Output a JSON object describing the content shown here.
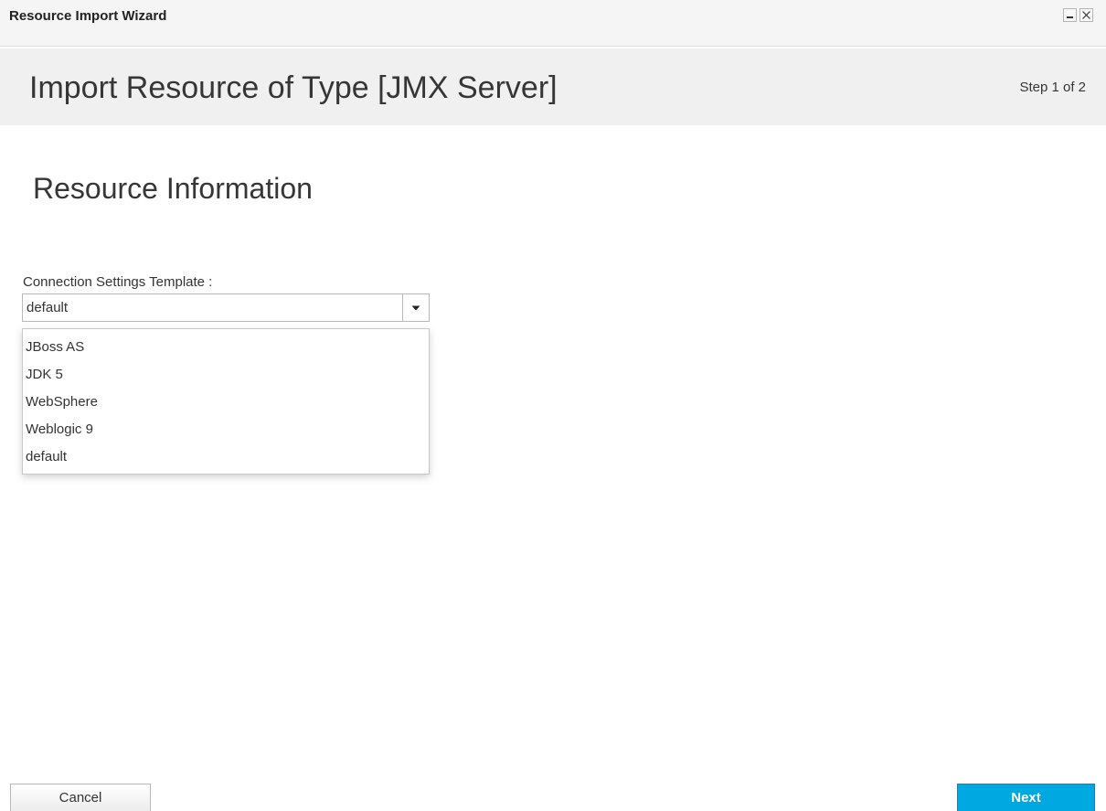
{
  "window": {
    "title": "Resource Import Wizard",
    "minimize_icon": "minimize-icon",
    "close_icon": "close-icon"
  },
  "header": {
    "title": "Import Resource of Type [JMX Server]",
    "step": "Step 1 of 2"
  },
  "section": {
    "title": "Resource Information"
  },
  "form": {
    "connection_template": {
      "label": "Connection Settings Template :",
      "selected": "default",
      "arrow_icon": "caret-down-icon",
      "options": [
        "JBoss AS",
        "JDK 5",
        "WebSphere",
        "Weblogic 9",
        "default"
      ]
    }
  },
  "footer": {
    "cancel_label": "Cancel",
    "next_label": "Next"
  },
  "colors": {
    "accent": "#00a8e1",
    "header_bg": "#f0f0f0"
  }
}
